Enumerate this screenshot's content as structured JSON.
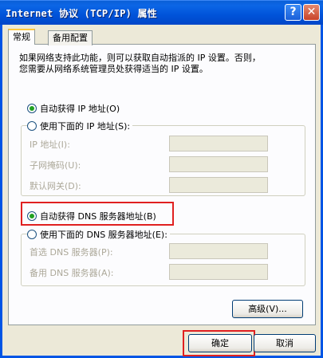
{
  "window": {
    "title": "Internet 协议 (TCP/IP) 属性",
    "help_glyph": "?",
    "close_glyph": "✕"
  },
  "tabs": [
    {
      "label": "常规"
    },
    {
      "label": "备用配置"
    }
  ],
  "description": {
    "line1": "如果网络支持此功能，则可以获取自动指派的 IP 设置。否则，",
    "line2": "您需要从网络系统管理员处获得适当的 IP 设置。"
  },
  "ip": {
    "auto_label": "自动获得 IP 地址(O)",
    "manual_label": "使用下面的 IP 地址(S):",
    "fields": [
      {
        "label": "IP 地址(I):"
      },
      {
        "label": "子网掩码(U):"
      },
      {
        "label": "默认网关(D):"
      }
    ]
  },
  "dns": {
    "auto_label": "自动获得 DNS 服务器地址(B)",
    "manual_label": "使用下面的 DNS 服务器地址(E):",
    "fields": [
      {
        "label": "首选 DNS 服务器(P):"
      },
      {
        "label": "备用 DNS 服务器(A):"
      }
    ]
  },
  "buttons": {
    "advanced": "高级(V)...",
    "ok": "确定",
    "cancel": "取消"
  },
  "colors": {
    "title_bar": "#0a5fd7",
    "highlight": "#e02020",
    "radio_selected": "#21a121"
  }
}
